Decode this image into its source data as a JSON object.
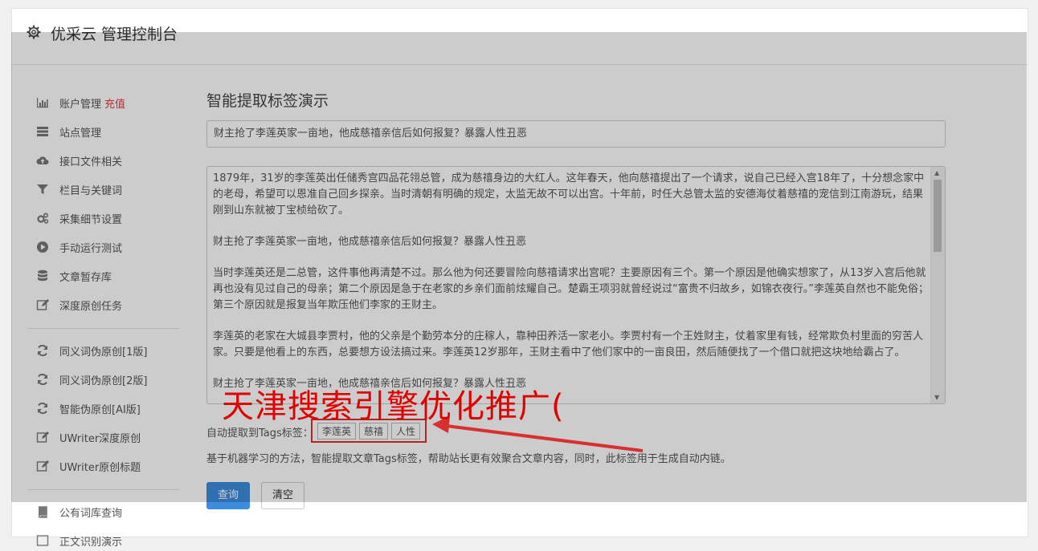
{
  "header": {
    "title": "优采云 管理控制台",
    "icon": "gear-icon"
  },
  "sidebar": {
    "group1": [
      {
        "label": "账户管理",
        "badge": "充值",
        "icon": "bar-chart-icon"
      },
      {
        "label": "站点管理",
        "icon": "server-icon"
      },
      {
        "label": "接口文件相关",
        "icon": "cloud-upload-icon"
      },
      {
        "label": "栏目与关键词",
        "icon": "filter-icon"
      },
      {
        "label": "采集细节设置",
        "icon": "gears-icon"
      },
      {
        "label": "手动运行测试",
        "icon": "play-circle-icon"
      },
      {
        "label": "文章暂存库",
        "icon": "database-icon"
      },
      {
        "label": "深度原创任务",
        "icon": "edit-icon"
      }
    ],
    "group2": [
      {
        "label": "同义词伪原创[1版]",
        "icon": "refresh-icon"
      },
      {
        "label": "同义词伪原创[2版]",
        "icon": "refresh-icon"
      },
      {
        "label": "智能伪原创[AI版]",
        "icon": "refresh-icon"
      },
      {
        "label": "UWriter深度原创",
        "icon": "edit-icon"
      },
      {
        "label": "UWriter原创标题",
        "icon": "edit-icon"
      }
    ],
    "group3": [
      {
        "label": "公有词库查询",
        "icon": "book-icon"
      },
      {
        "label": "正文识别演示",
        "icon": "square-icon"
      }
    ]
  },
  "main": {
    "heading": "智能提取标签演示",
    "title_value": "财主抢了李莲英家一亩地，他成慈禧亲信后如何报复？暴露人性丑恶",
    "content_paragraphs": [
      "1879年，31岁的李莲英出任储秀宫四品花翎总管，成为慈禧身边的大红人。这年春天，他向慈禧提出了一个请求，说自己已经入宫18年了，十分想念家中的老母，希望可以恩准自己回乡探亲。当时清朝有明确的规定，太监无故不可以出宫。十年前，时任大总管太监的安德海仗着慈禧的宠信到江南游玩，结果刚到山东就被丁宝桢给砍了。",
      "财主抢了李莲英家一亩地，他成慈禧亲信后如何报复？暴露人性丑恶",
      "当时李莲英还是二总管，这件事他再清楚不过。那么他为何还要冒险向慈禧请求出宫呢？主要原因有三个。第一个原因是他确实想家了，从13岁入宫后他就再也没有见过自己的母亲；第二个原因是急于在老家的乡亲们面前炫耀自己。楚霸王项羽就曾经说过“富贵不归故乡，如锦衣夜行。”李莲英自然也不能免俗；第三个原因就是报复当年欺压他们李家的王财主。",
      "李莲英的老家在大城县李贾村，他的父亲是个勤劳本分的庄稼人，靠种田养活一家老小。李贾村有一个王姓财主，仗着家里有钱，经常欺负村里面的穷苦人家。只要是他看上的东西，总要想方设法搞过来。李莲英12岁那年，王财主看中了他们家中的一亩良田，然后随便找了一个借口就把这块地给霸占了。",
      "财主抢了李莲英家一亩地，他成慈禧亲信后如何报复？暴露人性丑恶"
    ],
    "tags_label": "自动提取到Tags标签：",
    "tags": [
      "李莲英",
      "慈禧",
      "人性"
    ],
    "description": "基于机器学习的方法，智能提取文章Tags标签，帮助站长更有效聚合文章内容，同时，此标签用于生成自动内链。",
    "query_button": "查询",
    "clear_button": "清空"
  },
  "watermark": "天津搜索引擎优化推广("
}
